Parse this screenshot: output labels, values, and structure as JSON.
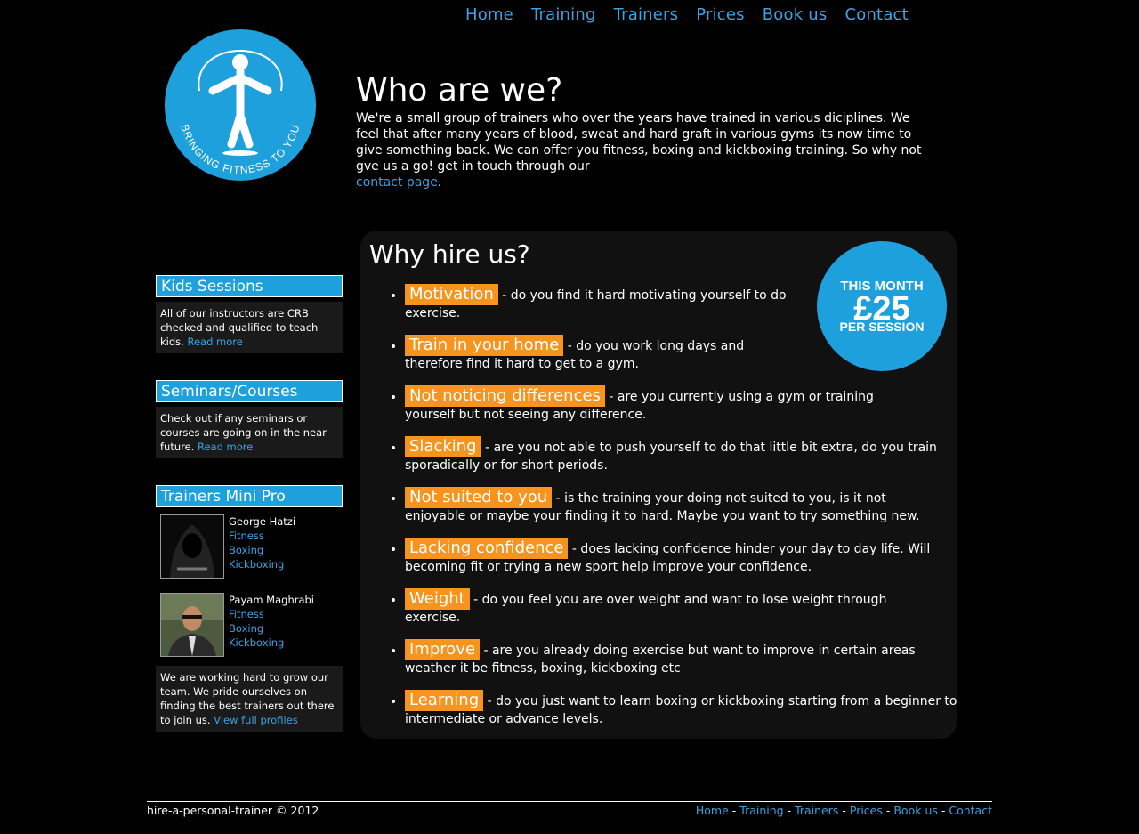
{
  "nav": [
    "Home",
    "Training",
    "Trainers",
    "Prices",
    "Book us",
    "Contact"
  ],
  "logo": {
    "text": "BRINGING FITNESS TO YOU",
    "color": "#1ea0dc"
  },
  "about": {
    "title": "Who are we?",
    "body": "We're a small group of trainers who over the years have trained in various diciplines. We feel that after many years of blood, sweat and hard graft in various gyms its now time to give something back. We can offer you fitness, boxing and kickboxing training. So why not gve us a go! get in touch through our",
    "link": "contact page",
    "end": "."
  },
  "sidebar": {
    "kids": {
      "title": "Kids Sessions",
      "text": "All of our instructors are CRB checked and qualified to teach kids.",
      "link": "Read more"
    },
    "seminars": {
      "title": "Seminars/Courses",
      "text": "Check out if any seminars or courses are going on in the near future.",
      "link": "Read more"
    },
    "trainers": {
      "title": "Trainers Mini Pro",
      "people": [
        {
          "name": "George Hatzi",
          "skills": [
            "Fitness",
            "Boxing",
            "Kickboxing"
          ]
        },
        {
          "name": "Payam Maghrabi",
          "skills": [
            "Fitness",
            "Boxing",
            "Kickboxing"
          ]
        }
      ],
      "text": "We are working hard to grow our team. We pride ourselves on finding the best trainers out there to join us.",
      "link": "View full profiles"
    }
  },
  "why": {
    "title": "Why hire us?",
    "badge": {
      "line1": "THIS MONTH",
      "line2": "£25",
      "line3": "PER SESSION"
    },
    "items": [
      {
        "tag": "Motivation",
        "text": " - do you find it hard motivating yourself to do exercise."
      },
      {
        "tag": "Train in your home",
        "text": " - do you work long days and therefore find it hard to get to a gym."
      },
      {
        "tag": "Not noticing differences",
        "text": " - are you currently using a gym or training yourself but not seeing any difference."
      },
      {
        "tag": "Slacking",
        "text": " - are you not able to push yourself to do that little bit extra, do you train sporadically or for short periods."
      },
      {
        "tag": "Not suited to you",
        "text": " - is the training your doing not suited to you, is it not enjoyable or maybe your finding it to hard. Maybe you want to try something new."
      },
      {
        "tag": "Lacking confidence",
        "text": " - does lacking confidence hinder your day to day life. Will becoming fit or trying a new sport help improve your confidence."
      },
      {
        "tag": "Weight",
        "text": " - do you feel you are over weight and want to lose weight through exercise."
      },
      {
        "tag": "Improve",
        "text": " - are you already doing exercise but want to improve in certain areas weather it be fitness, boxing, kickboxing etc"
      },
      {
        "tag": "Learning",
        "text": " - do you just want to learn boxing or kickboxing starting from a beginner to intermediate or advance levels."
      }
    ]
  },
  "footer": {
    "copy": "hire-a-personal-trainer © 2012",
    "links": [
      "Home",
      "Training",
      "Trainers",
      "Prices",
      "Book us",
      "Contact"
    ],
    "sep": " - "
  }
}
